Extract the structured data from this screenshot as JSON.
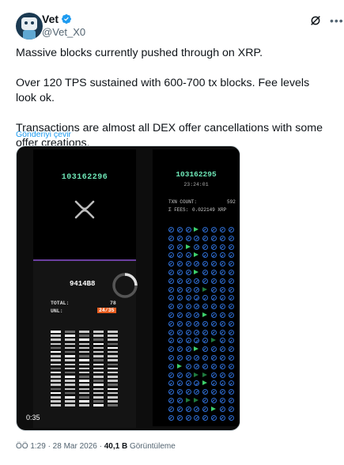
{
  "author": {
    "name": "Vet",
    "handle": "@Vet_X0"
  },
  "tweet": {
    "line1": "Massive blocks currently pushed through on XRP.",
    "line2": "Over 120 TPS sustained with 600-700 tx blocks. Fee levels look ok.",
    "line3": "Transactions are almost all DEX offer cancellations with some offer creations.",
    "translate": "Gönderiyi çevir"
  },
  "video": {
    "left": {
      "block_number": "103162296",
      "hash": "9414B8",
      "total_label": "TOTAL:",
      "total_value": "78",
      "unl_label": "UNL:",
      "unl_value": "24/35"
    },
    "right": {
      "block_number": "103162295",
      "time": "23:24:01",
      "txn_label": "TXN COUNT:",
      "txn_value": "592",
      "fees_label": "Σ FEES:",
      "fees_value": "0.022149 XRP"
    },
    "timer": "0:35"
  },
  "footer": {
    "time": "ÖÖ 1:29 · 28 Mar 2026 · ",
    "views": "40,1 B",
    "views_label": " Görüntüleme"
  },
  "colors": {
    "accent": "#1d9bf0",
    "green": "#6ee7b7",
    "orange": "#e85d1f",
    "blue": "#2f6fd6"
  }
}
